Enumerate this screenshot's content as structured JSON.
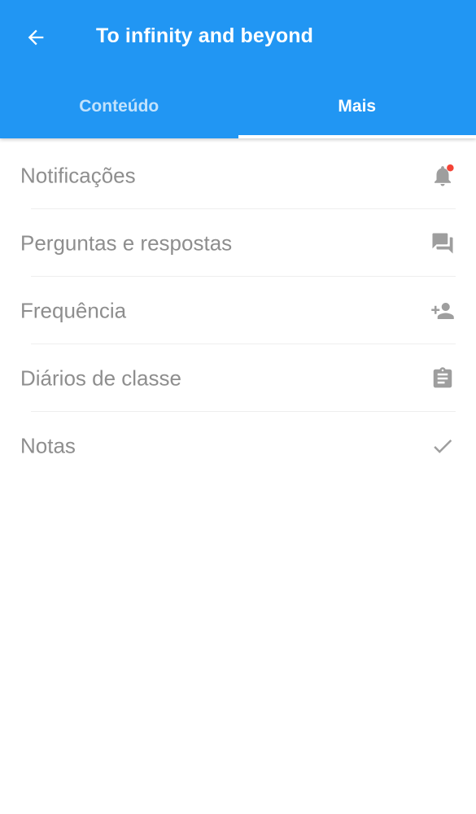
{
  "appbar": {
    "title": "To infinity and beyond",
    "background_color": "#2196f3",
    "back_icon": "arrow-back-icon"
  },
  "tabs": [
    {
      "label": "Conteúdo",
      "active": false
    },
    {
      "label": "Mais",
      "active": true
    }
  ],
  "menu": {
    "items": [
      {
        "label": "Notificações",
        "icon": "bell-icon",
        "has_badge": true,
        "badge_color": "#f44336"
      },
      {
        "label": "Perguntas e respostas",
        "icon": "forum-icon"
      },
      {
        "label": "Frequência",
        "icon": "person-add-icon"
      },
      {
        "label": "Diários de classe",
        "icon": "clipboard-icon"
      },
      {
        "label": "Notas",
        "icon": "check-icon"
      }
    ],
    "text_color": "#8e8e8e",
    "icon_color": "#9e9e9e"
  }
}
